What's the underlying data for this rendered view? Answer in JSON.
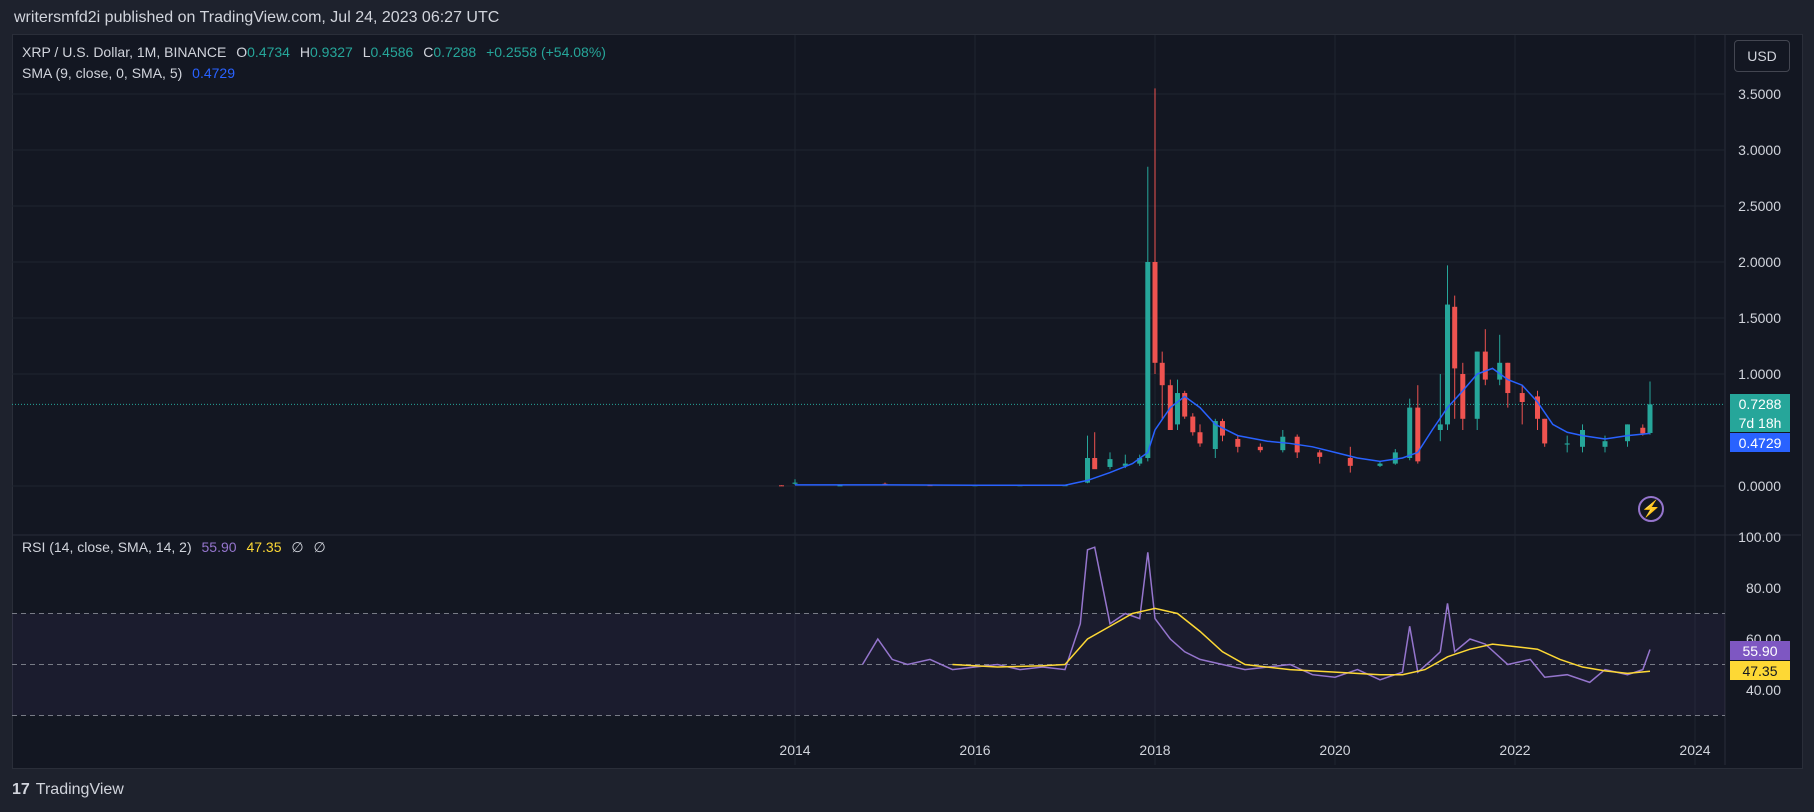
{
  "header": {
    "published_text": "writersmfd2i published on TradingView.com, Jul 24, 2023 06:27 UTC"
  },
  "legend": {
    "symbol": "XRP / U.S. Dollar, 1M, BINANCE",
    "o_label": "O",
    "o_value": "0.4734",
    "h_label": "H",
    "h_value": "0.9327",
    "l_label": "L",
    "l_value": "0.4586",
    "c_label": "C",
    "c_value": "0.7288",
    "change": "+0.2558 (+54.08%)",
    "sma_label": "SMA (9, close, 0, SMA, 5)",
    "sma_value": "0.4729"
  },
  "rsi_legend": {
    "label": "RSI (14, close, SMA, 14, 2)",
    "rsi_value": "55.90",
    "rsi_ma_value": "47.35",
    "empty1": "∅",
    "empty2": "∅"
  },
  "currency_button": "USD",
  "price_tags": {
    "last_price": "0.7288",
    "countdown": "7d 18h",
    "sma": "0.4729",
    "rsi": "55.90",
    "rsi_ma": "47.35"
  },
  "footer": {
    "logo": "17",
    "brand": "TradingView"
  },
  "colors": {
    "up": "#26a69a",
    "down": "#ef5350",
    "sma": "#2962ff",
    "rsi": "#9575cd",
    "rsi_ma": "#fdd835",
    "background": "#131722"
  },
  "icons": {
    "flash": "flash-icon",
    "logo": "tradingview-logo-icon"
  },
  "chart_data": [
    {
      "type": "candlestick",
      "title": "XRP / U.S. Dollar, 1M, BINANCE",
      "y_ticks": [
        "3.5000",
        "3.0000",
        "2.5000",
        "2.0000",
        "1.5000",
        "1.0000",
        "0.0000"
      ],
      "x_ticks": [
        "2014",
        "2016",
        "2018",
        "2020",
        "2022",
        "2024"
      ],
      "ylim": [
        0,
        3.5
      ],
      "xlim": [
        2013.0,
        2024.1
      ],
      "grid": true,
      "candles": [
        {
          "t": 2013.85,
          "o": 0.006,
          "h": 0.007,
          "l": 0.004,
          "c": 0.005
        },
        {
          "t": 2014.0,
          "o": 0.02,
          "h": 0.06,
          "l": 0.01,
          "c": 0.03
        },
        {
          "t": 2014.5,
          "o": 0.005,
          "h": 0.01,
          "l": 0.004,
          "c": 0.006
        },
        {
          "t": 2015.0,
          "o": 0.02,
          "h": 0.03,
          "l": 0.01,
          "c": 0.015
        },
        {
          "t": 2015.5,
          "o": 0.008,
          "h": 0.01,
          "l": 0.006,
          "c": 0.007
        },
        {
          "t": 2016.0,
          "o": 0.006,
          "h": 0.008,
          "l": 0.005,
          "c": 0.007
        },
        {
          "t": 2016.5,
          "o": 0.007,
          "h": 0.008,
          "l": 0.006,
          "c": 0.007
        },
        {
          "t": 2017.0,
          "o": 0.006,
          "h": 0.008,
          "l": 0.005,
          "c": 0.007
        },
        {
          "t": 2017.25,
          "o": 0.03,
          "h": 0.45,
          "l": 0.025,
          "c": 0.25
        },
        {
          "t": 2017.33,
          "o": 0.25,
          "h": 0.48,
          "l": 0.18,
          "c": 0.15
        },
        {
          "t": 2017.5,
          "o": 0.17,
          "h": 0.3,
          "l": 0.15,
          "c": 0.24
        },
        {
          "t": 2017.67,
          "o": 0.18,
          "h": 0.28,
          "l": 0.16,
          "c": 0.2
        },
        {
          "t": 2017.83,
          "o": 0.2,
          "h": 0.28,
          "l": 0.18,
          "c": 0.25
        },
        {
          "t": 2017.92,
          "o": 0.25,
          "h": 2.85,
          "l": 0.22,
          "c": 2.0
        },
        {
          "t": 2018.0,
          "o": 2.0,
          "h": 3.55,
          "l": 1.0,
          "c": 1.1
        },
        {
          "t": 2018.08,
          "o": 1.1,
          "h": 1.2,
          "l": 0.6,
          "c": 0.9
        },
        {
          "t": 2018.17,
          "o": 0.9,
          "h": 0.95,
          "l": 0.5,
          "c": 0.5
        },
        {
          "t": 2018.25,
          "o": 0.55,
          "h": 0.95,
          "l": 0.5,
          "c": 0.83
        },
        {
          "t": 2018.33,
          "o": 0.83,
          "h": 0.85,
          "l": 0.6,
          "c": 0.62
        },
        {
          "t": 2018.42,
          "o": 0.62,
          "h": 0.65,
          "l": 0.45,
          "c": 0.48
        },
        {
          "t": 2018.5,
          "o": 0.48,
          "h": 0.55,
          "l": 0.35,
          "c": 0.38
        },
        {
          "t": 2018.67,
          "o": 0.33,
          "h": 0.6,
          "l": 0.25,
          "c": 0.58
        },
        {
          "t": 2018.75,
          "o": 0.58,
          "h": 0.6,
          "l": 0.4,
          "c": 0.45
        },
        {
          "t": 2018.92,
          "o": 0.42,
          "h": 0.45,
          "l": 0.3,
          "c": 0.35
        },
        {
          "t": 2019.17,
          "o": 0.35,
          "h": 0.38,
          "l": 0.3,
          "c": 0.32
        },
        {
          "t": 2019.42,
          "o": 0.32,
          "h": 0.5,
          "l": 0.3,
          "c": 0.44
        },
        {
          "t": 2019.58,
          "o": 0.44,
          "h": 0.46,
          "l": 0.25,
          "c": 0.3
        },
        {
          "t": 2019.83,
          "o": 0.3,
          "h": 0.32,
          "l": 0.2,
          "c": 0.26
        },
        {
          "t": 2020.17,
          "o": 0.25,
          "h": 0.35,
          "l": 0.12,
          "c": 0.18
        },
        {
          "t": 2020.5,
          "o": 0.18,
          "h": 0.22,
          "l": 0.17,
          "c": 0.2
        },
        {
          "t": 2020.67,
          "o": 0.2,
          "h": 0.33,
          "l": 0.19,
          "c": 0.3
        },
        {
          "t": 2020.83,
          "o": 0.25,
          "h": 0.78,
          "l": 0.23,
          "c": 0.7
        },
        {
          "t": 2020.92,
          "o": 0.7,
          "h": 0.9,
          "l": 0.2,
          "c": 0.22
        },
        {
          "t": 2021.17,
          "o": 0.5,
          "h": 1.0,
          "l": 0.4,
          "c": 0.55
        },
        {
          "t": 2021.25,
          "o": 0.55,
          "h": 1.97,
          "l": 0.5,
          "c": 1.62
        },
        {
          "t": 2021.33,
          "o": 1.6,
          "h": 1.7,
          "l": 0.6,
          "c": 1.05
        },
        {
          "t": 2021.42,
          "o": 1.0,
          "h": 1.1,
          "l": 0.5,
          "c": 0.6
        },
        {
          "t": 2021.58,
          "o": 0.6,
          "h": 1.2,
          "l": 0.5,
          "c": 1.2
        },
        {
          "t": 2021.67,
          "o": 1.2,
          "h": 1.4,
          "l": 0.9,
          "c": 0.95
        },
        {
          "t": 2021.83,
          "o": 0.95,
          "h": 1.35,
          "l": 0.9,
          "c": 1.1
        },
        {
          "t": 2021.92,
          "o": 1.1,
          "h": 1.1,
          "l": 0.7,
          "c": 0.83
        },
        {
          "t": 2022.08,
          "o": 0.83,
          "h": 0.9,
          "l": 0.55,
          "c": 0.75
        },
        {
          "t": 2022.25,
          "o": 0.8,
          "h": 0.85,
          "l": 0.5,
          "c": 0.6
        },
        {
          "t": 2022.33,
          "o": 0.6,
          "h": 0.6,
          "l": 0.35,
          "c": 0.38
        },
        {
          "t": 2022.58,
          "o": 0.37,
          "h": 0.45,
          "l": 0.3,
          "c": 0.38
        },
        {
          "t": 2022.75,
          "o": 0.35,
          "h": 0.55,
          "l": 0.3,
          "c": 0.5
        },
        {
          "t": 2023.0,
          "o": 0.35,
          "h": 0.45,
          "l": 0.3,
          "c": 0.4
        },
        {
          "t": 2023.25,
          "o": 0.4,
          "h": 0.55,
          "l": 0.35,
          "c": 0.55
        },
        {
          "t": 2023.42,
          "o": 0.52,
          "h": 0.55,
          "l": 0.45,
          "c": 0.47
        },
        {
          "t": 2023.5,
          "o": 0.4734,
          "h": 0.9327,
          "l": 0.4586,
          "c": 0.7288
        }
      ],
      "sma_series": {
        "name": "SMA (9, close, 0, SMA, 5)",
        "x": [
          2014.0,
          2015.0,
          2016.0,
          2017.0,
          2017.25,
          2017.5,
          2017.75,
          2017.92,
          2018.0,
          2018.17,
          2018.33,
          2018.5,
          2018.67,
          2018.92,
          2019.25,
          2019.5,
          2019.75,
          2020.0,
          2020.25,
          2020.5,
          2020.75,
          2020.92,
          2021.08,
          2021.25,
          2021.42,
          2021.58,
          2021.75,
          2021.92,
          2022.08,
          2022.25,
          2022.42,
          2022.58,
          2022.75,
          2023.0,
          2023.25,
          2023.5
        ],
        "y": [
          0.01,
          0.01,
          0.007,
          0.007,
          0.05,
          0.12,
          0.2,
          0.3,
          0.5,
          0.7,
          0.8,
          0.7,
          0.55,
          0.45,
          0.4,
          0.38,
          0.35,
          0.3,
          0.25,
          0.22,
          0.25,
          0.3,
          0.5,
          0.7,
          0.85,
          1.0,
          1.05,
          0.95,
          0.9,
          0.75,
          0.55,
          0.48,
          0.45,
          0.42,
          0.45,
          0.47
        ]
      }
    },
    {
      "type": "line",
      "title": "RSI (14, close, SMA, 14, 2)",
      "y_ticks": [
        "100.00",
        "80.00",
        "60.00",
        "40.00"
      ],
      "ylim": [
        30,
        100
      ],
      "band": [
        30,
        70
      ],
      "series": [
        {
          "name": "RSI",
          "x": [
            2014.75,
            2014.92,
            2015.08,
            2015.25,
            2015.5,
            2015.75,
            2016.0,
            2016.25,
            2016.5,
            2016.75,
            2017.0,
            2017.17,
            2017.25,
            2017.33,
            2017.5,
            2017.67,
            2017.83,
            2017.92,
            2018.0,
            2018.17,
            2018.33,
            2018.5,
            2018.75,
            2019.0,
            2019.5,
            2019.75,
            2020.0,
            2020.25,
            2020.5,
            2020.75,
            2020.83,
            2020.92,
            2021.08,
            2021.17,
            2021.25,
            2021.33,
            2021.5,
            2021.67,
            2021.92,
            2022.17,
            2022.33,
            2022.58,
            2022.83,
            2023.0,
            2023.25,
            2023.42,
            2023.5
          ],
          "y": [
            50,
            60,
            52,
            50,
            52,
            48,
            49,
            50,
            48,
            49,
            48,
            66,
            95,
            96,
            66,
            70,
            68,
            94,
            68,
            60,
            55,
            52,
            50,
            48,
            50,
            46,
            45,
            48,
            44,
            47,
            65,
            47,
            52,
            55,
            74,
            55,
            60,
            58,
            50,
            52,
            45,
            46,
            43,
            48,
            46,
            48,
            55.9
          ]
        },
        {
          "name": "RSI-based MA",
          "x": [
            2015.75,
            2016.25,
            2016.75,
            2017.0,
            2017.25,
            2017.5,
            2017.75,
            2018.0,
            2018.25,
            2018.5,
            2018.75,
            2019.0,
            2019.5,
            2020.0,
            2020.5,
            2020.75,
            2021.0,
            2021.25,
            2021.5,
            2021.75,
            2022.0,
            2022.25,
            2022.5,
            2022.75,
            2023.0,
            2023.25,
            2023.5
          ],
          "y": [
            50,
            49,
            49.5,
            50,
            60,
            65,
            70,
            72,
            70,
            63,
            55,
            50,
            48,
            47,
            46,
            46,
            48,
            53,
            56,
            58,
            57,
            56,
            52,
            49,
            47.5,
            46.5,
            47.35
          ]
        }
      ]
    }
  ]
}
